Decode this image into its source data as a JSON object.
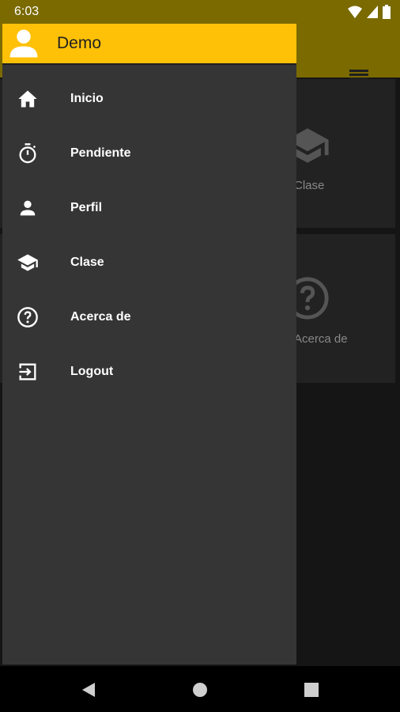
{
  "status_bar": {
    "time": "6:03"
  },
  "drawer": {
    "user_name": "Demo",
    "items": [
      {
        "label": "Inicio",
        "icon": "home-icon"
      },
      {
        "label": "Pendiente",
        "icon": "stopwatch-icon"
      },
      {
        "label": "Perfil",
        "icon": "person-icon"
      },
      {
        "label": "Clase",
        "icon": "school-icon"
      },
      {
        "label": "Acerca de",
        "icon": "help-circle-icon"
      },
      {
        "label": "Logout",
        "icon": "exit-icon"
      }
    ]
  },
  "background_cards": [
    {
      "label": "Clase",
      "icon": "school-icon"
    },
    {
      "label": "Acerca de",
      "icon": "help-circle-icon"
    }
  ],
  "colors": {
    "accent": "#ffc107",
    "toolbar": "#7a6a00",
    "drawer_bg": "#353535"
  }
}
